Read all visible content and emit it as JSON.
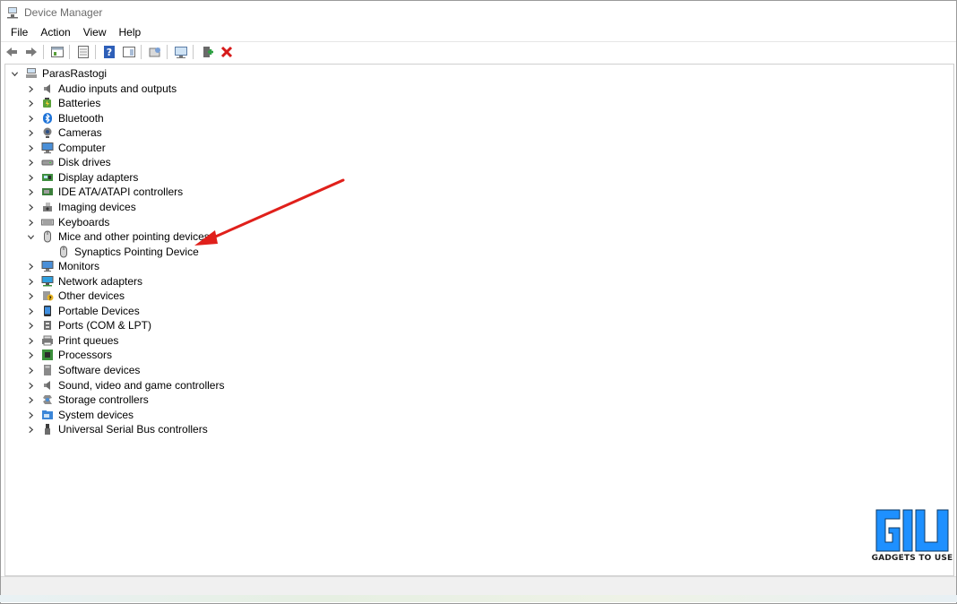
{
  "window": {
    "title": "Device Manager"
  },
  "menu": [
    "File",
    "Action",
    "View",
    "Help"
  ],
  "toolbar": [
    {
      "icon": "back-arrow-icon"
    },
    {
      "icon": "forward-arrow-icon"
    },
    {
      "icon": "properties-icon"
    },
    {
      "icon": "show-hidden-icon"
    },
    {
      "icon": "help-icon"
    },
    {
      "icon": "action-pane-icon"
    },
    {
      "icon": "update-driver-icon"
    },
    {
      "icon": "scan-hardware-icon"
    },
    {
      "icon": "enable-device-icon"
    },
    {
      "icon": "uninstall-x-icon"
    }
  ],
  "tree": {
    "root": {
      "label": "ParasRastogi",
      "icon": "computer-root-icon",
      "expanded": true
    },
    "categories": [
      {
        "label": "Audio inputs and outputs",
        "icon": "speaker-icon"
      },
      {
        "label": "Batteries",
        "icon": "battery-icon"
      },
      {
        "label": "Bluetooth",
        "icon": "bluetooth-icon"
      },
      {
        "label": "Cameras",
        "icon": "camera-icon"
      },
      {
        "label": "Computer",
        "icon": "monitor-icon"
      },
      {
        "label": "Disk drives",
        "icon": "disk-drive-icon"
      },
      {
        "label": "Display adapters",
        "icon": "display-adapter-icon"
      },
      {
        "label": "IDE ATA/ATAPI controllers",
        "icon": "ide-controller-icon"
      },
      {
        "label": "Imaging devices",
        "icon": "imaging-icon"
      },
      {
        "label": "Keyboards",
        "icon": "keyboard-icon"
      },
      {
        "label": "Mice and other pointing devices",
        "icon": "mouse-icon",
        "expanded": true,
        "children": [
          {
            "label": "Synaptics Pointing Device",
            "icon": "mouse-icon"
          }
        ]
      },
      {
        "label": "Monitors",
        "icon": "monitor-icon"
      },
      {
        "label": "Network adapters",
        "icon": "network-icon"
      },
      {
        "label": "Other devices",
        "icon": "other-device-icon"
      },
      {
        "label": "Portable Devices",
        "icon": "portable-device-icon"
      },
      {
        "label": "Ports (COM & LPT)",
        "icon": "port-icon"
      },
      {
        "label": "Print queues",
        "icon": "printer-icon"
      },
      {
        "label": "Processors",
        "icon": "processor-icon"
      },
      {
        "label": "Software devices",
        "icon": "software-device-icon"
      },
      {
        "label": "Sound, video and game controllers",
        "icon": "speaker-icon"
      },
      {
        "label": "Storage controllers",
        "icon": "storage-icon"
      },
      {
        "label": "System devices",
        "icon": "system-folder-icon"
      },
      {
        "label": "Universal Serial Bus controllers",
        "icon": "usb-icon"
      }
    ]
  },
  "annotation": {
    "color": "#e0201b"
  },
  "watermark": {
    "text": "GADGETS TO USE",
    "color": "#1e90ff"
  }
}
